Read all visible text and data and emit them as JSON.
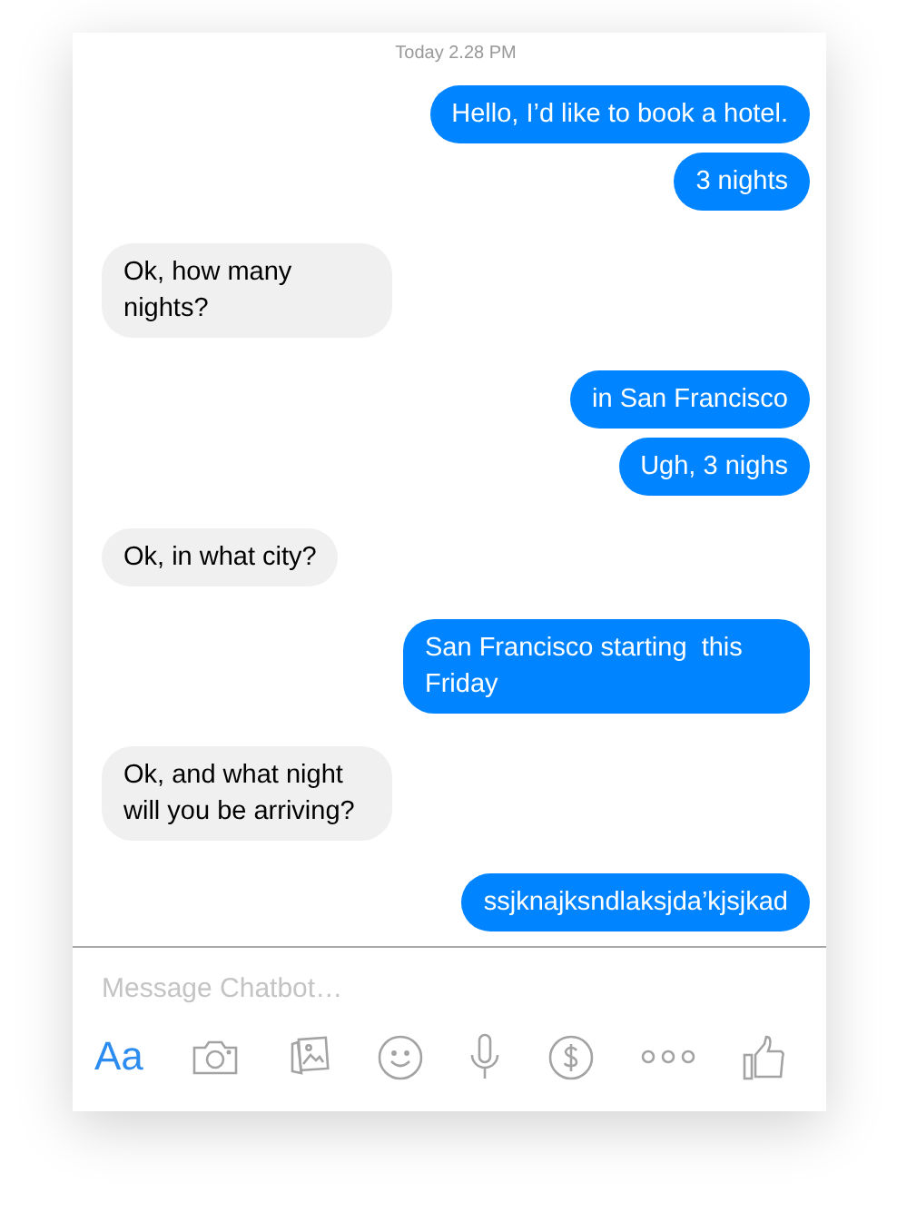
{
  "timestamp": "Today 2.28 PM",
  "messages": [
    {
      "kind": "sent",
      "text": "Hello, I’d like to book a hotel."
    },
    {
      "kind": "sent",
      "text": "3 nights"
    },
    {
      "kind": "received",
      "text": "Ok, how many nights?"
    },
    {
      "kind": "sent",
      "text": "in San Francisco"
    },
    {
      "kind": "sent",
      "text": "Ugh, 3 nighs"
    },
    {
      "kind": "received",
      "text": "Ok, in what city?"
    },
    {
      "kind": "sent",
      "text": "San Francisco starting  this Friday"
    },
    {
      "kind": "received",
      "text": "Ok, and what night will you be arriving?"
    },
    {
      "kind": "sent",
      "text": "ssjknajksndlaksjda’kjsjkad"
    }
  ],
  "composer": {
    "placeholder": "Message Chatbot…"
  },
  "toolbar": {
    "text_button": "Aa",
    "icons": [
      {
        "kind": "camera"
      },
      {
        "kind": "photos"
      },
      {
        "kind": "emoji"
      },
      {
        "kind": "microphone"
      },
      {
        "kind": "payment"
      },
      {
        "kind": "more"
      },
      {
        "kind": "like"
      }
    ]
  }
}
